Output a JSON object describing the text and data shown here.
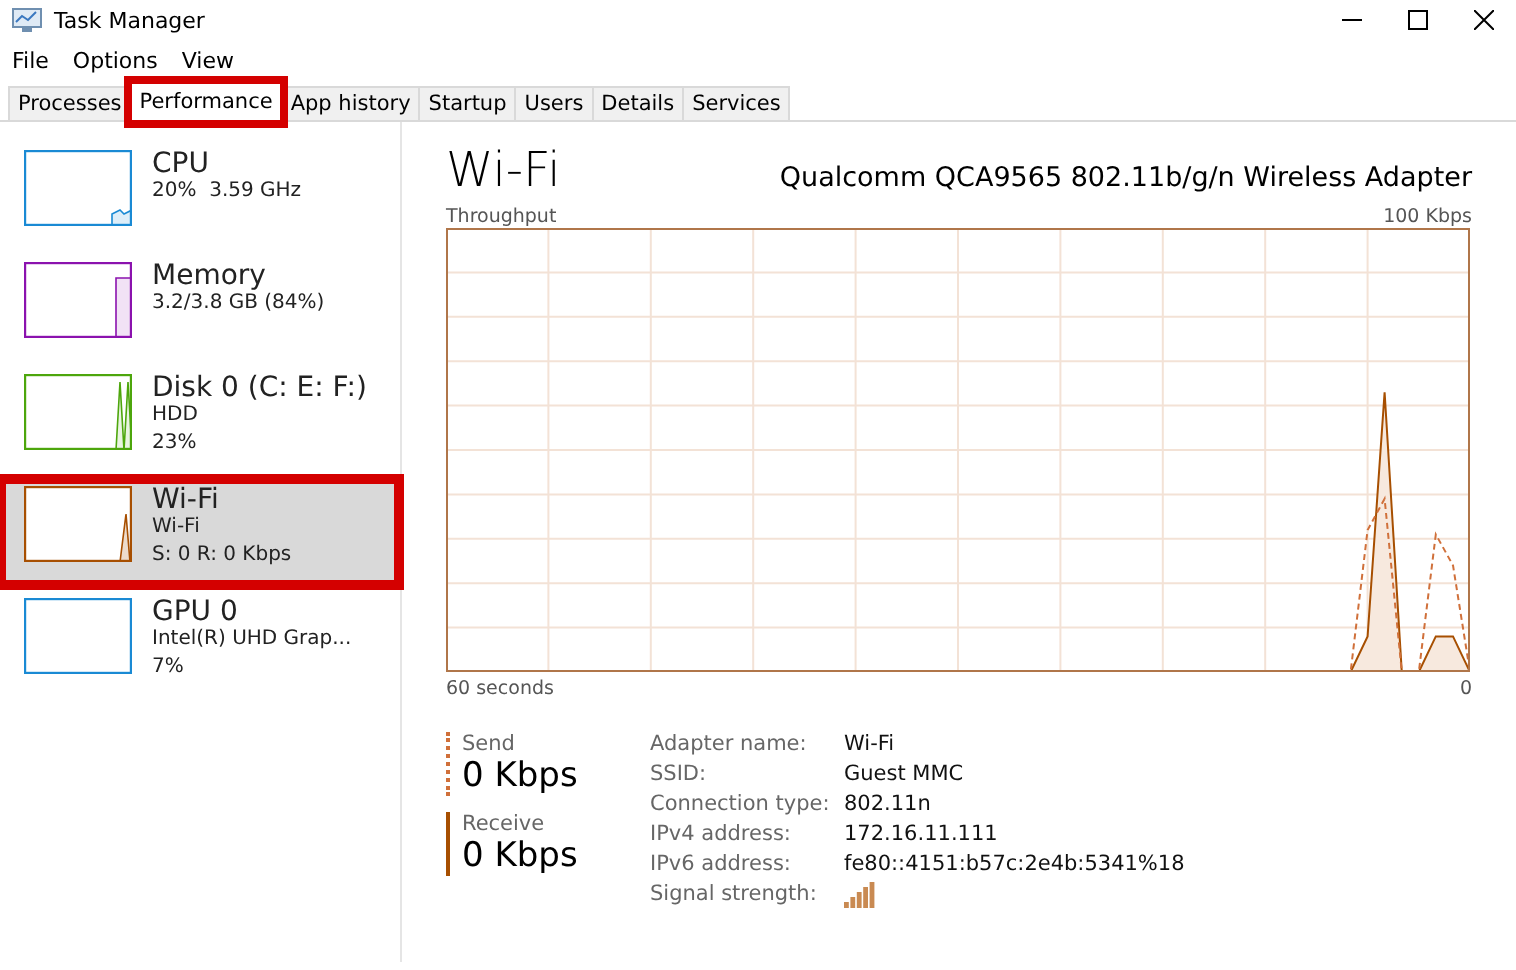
{
  "window": {
    "title": "Task Manager"
  },
  "menu": [
    "File",
    "Options",
    "View"
  ],
  "tabs": [
    {
      "label": "Processes",
      "selected": false,
      "highlighted": false
    },
    {
      "label": "Performance",
      "selected": true,
      "highlighted": true
    },
    {
      "label": "App history",
      "selected": false,
      "highlighted": false
    },
    {
      "label": "Startup",
      "selected": false,
      "highlighted": false
    },
    {
      "label": "Users",
      "selected": false,
      "highlighted": false
    },
    {
      "label": "Details",
      "selected": false,
      "highlighted": false
    },
    {
      "label": "Services",
      "selected": false,
      "highlighted": false
    }
  ],
  "sidebar": {
    "items": [
      {
        "kind": "cpu",
        "name": "CPU",
        "lines": [
          "20%  3.59 GHz"
        ],
        "color": "#1a8ad4",
        "selected": false,
        "highlighted": false
      },
      {
        "kind": "memory",
        "name": "Memory",
        "lines": [
          "3.2/3.8 GB (84%)"
        ],
        "color": "#8b12ae",
        "selected": false,
        "highlighted": false
      },
      {
        "kind": "disk",
        "name": "Disk 0 (C: E: F:)",
        "lines": [
          "HDD",
          "23%"
        ],
        "color": "#4da60c",
        "selected": false,
        "highlighted": false
      },
      {
        "kind": "network",
        "name": "Wi-Fi",
        "lines": [
          "Wi-Fi",
          "S: 0 R: 0 Kbps"
        ],
        "color": "#a74f01",
        "selected": true,
        "highlighted": true
      },
      {
        "kind": "gpu",
        "name": "GPU 0",
        "lines": [
          "Intel(R) UHD Grap...",
          "7%"
        ],
        "color": "#1a8ad4",
        "selected": false,
        "highlighted": false
      }
    ]
  },
  "detail": {
    "title": "Wi-Fi",
    "adapter": "Qualcomm QCA9565 802.11b/g/n Wireless Adapter",
    "graph": {
      "label": "Throughput",
      "max_label": "100 Kbps",
      "time_label": "60 seconds",
      "min_label": "0"
    },
    "stats": [
      {
        "kind": "send",
        "label": "Send",
        "value": "0 Kbps"
      },
      {
        "kind": "receive",
        "label": "Receive",
        "value": "0 Kbps"
      }
    ],
    "properties": [
      {
        "label": "Adapter name:",
        "value": "Wi-Fi"
      },
      {
        "label": "SSID:",
        "value": "Guest MMC"
      },
      {
        "label": "Connection type:",
        "value": "802.11n"
      },
      {
        "label": "IPv4 address:",
        "value": "172.16.11.111"
      },
      {
        "label": "IPv6 address:",
        "value": "fe80::4151:b57c:2e4b:5341%18"
      },
      {
        "kind": "signal",
        "label": "Signal strength:"
      }
    ]
  }
}
